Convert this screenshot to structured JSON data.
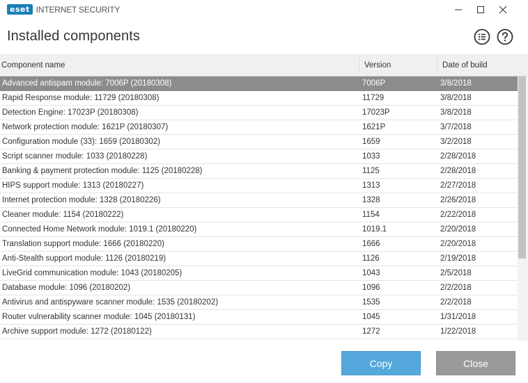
{
  "app": {
    "logo_text": "eset",
    "product_name": "INTERNET SECURITY"
  },
  "window_controls": {
    "minimize_icon": "minimize-icon",
    "maximize_icon": "maximize-icon",
    "close_icon": "close-icon"
  },
  "page": {
    "title": "Installed components",
    "list_icon": "list-icon",
    "help_icon": "help-icon"
  },
  "table": {
    "columns": {
      "name": "Component name",
      "version": "Version",
      "date": "Date of build"
    },
    "rows": [
      {
        "name": "Advanced antispam module: 7006P (20180308)",
        "version": "7006P",
        "date": "3/8/2018",
        "selected": true
      },
      {
        "name": "Rapid Response module: 11729 (20180308)",
        "version": "11729",
        "date": "3/8/2018"
      },
      {
        "name": "Detection Engine: 17023P (20180308)",
        "version": "17023P",
        "date": "3/8/2018"
      },
      {
        "name": "Network protection module: 1621P (20180307)",
        "version": "1621P",
        "date": "3/7/2018"
      },
      {
        "name": "Configuration module (33): 1659 (20180302)",
        "version": "1659",
        "date": "3/2/2018"
      },
      {
        "name": "Script scanner module: 1033 (20180228)",
        "version": "1033",
        "date": "2/28/2018"
      },
      {
        "name": "Banking & payment protection module: 1125 (20180228)",
        "version": "1125",
        "date": "2/28/2018"
      },
      {
        "name": "HIPS support module: 1313 (20180227)",
        "version": "1313",
        "date": "2/27/2018"
      },
      {
        "name": "Internet protection module: 1328 (20180226)",
        "version": "1328",
        "date": "2/26/2018"
      },
      {
        "name": "Cleaner module: 1154 (20180222)",
        "version": "1154",
        "date": "2/22/2018"
      },
      {
        "name": "Connected Home Network module: 1019.1 (20180220)",
        "version": "1019.1",
        "date": "2/20/2018"
      },
      {
        "name": "Translation support module: 1666 (20180220)",
        "version": "1666",
        "date": "2/20/2018"
      },
      {
        "name": "Anti-Stealth support module: 1126 (20180219)",
        "version": "1126",
        "date": "2/19/2018"
      },
      {
        "name": "LiveGrid communication module: 1043 (20180205)",
        "version": "1043",
        "date": "2/5/2018"
      },
      {
        "name": "Database module: 1096 (20180202)",
        "version": "1096",
        "date": "2/2/2018"
      },
      {
        "name": "Antivirus and antispyware scanner module: 1535 (20180202)",
        "version": "1535",
        "date": "2/2/2018"
      },
      {
        "name": "Router vulnerability scanner module: 1045 (20180131)",
        "version": "1045",
        "date": "1/31/2018"
      },
      {
        "name": "Archive support module: 1272 (20180122)",
        "version": "1272",
        "date": "1/22/2018"
      }
    ]
  },
  "buttons": {
    "copy": "Copy",
    "close": "Close"
  },
  "colors": {
    "brand": "#1b7fb5",
    "selected_row": "#8c8c8c",
    "copy_button": "#55a8db",
    "close_button": "#9a9a9a"
  }
}
